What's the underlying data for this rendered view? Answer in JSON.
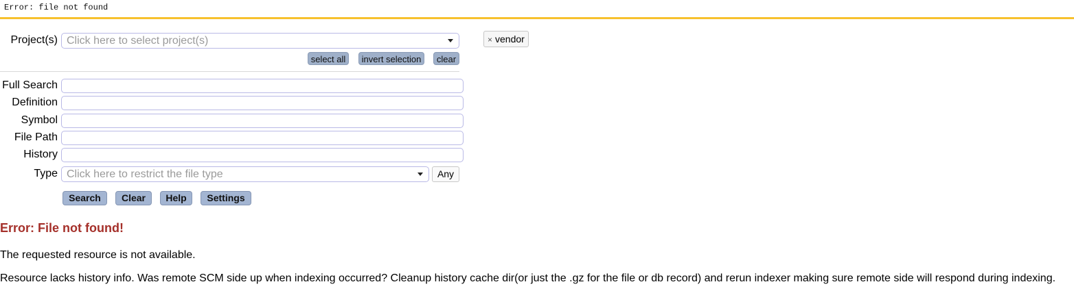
{
  "topbar": {
    "text": "Error: file not found"
  },
  "form": {
    "projects_label": "Project(s)",
    "projects_placeholder": "Click here to select project(s)",
    "select_all": "select all",
    "invert_selection": "invert selection",
    "clear_small": "clear",
    "full_search_label": "Full Search",
    "definition_label": "Definition",
    "symbol_label": "Symbol",
    "file_path_label": "File Path",
    "history_label": "History",
    "type_label": "Type",
    "type_placeholder": "Click here to restrict the file type",
    "any_button": "Any",
    "search_button": "Search",
    "clear_button": "Clear",
    "help_button": "Help",
    "settings_button": "Settings"
  },
  "selected_project": {
    "remove": "×",
    "label": "vendor"
  },
  "error": {
    "title": "Error: File not found!",
    "line1": "The requested resource is not available.",
    "line2": "Resource lacks history info. Was remote SCM side up when indexing occurred? Cleanup history cache dir(or just the .gz for the file or db record) and rerun indexer making sure remote side will respond during indexing."
  },
  "colors": {
    "accent_bar": "#f7c12d",
    "error_text": "#a5302a",
    "button_bg": "#a3b5d2"
  }
}
